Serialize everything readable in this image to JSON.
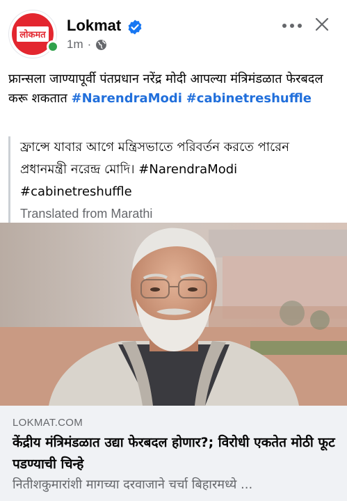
{
  "header": {
    "page_name": "Lokmat",
    "avatar_logo_text": "लोकमत",
    "timestamp": "1m",
    "separator": "·",
    "icons": {
      "verified": "verified-badge-icon",
      "privacy": "globe-icon",
      "more": "more-options-icon",
      "close": "close-icon"
    }
  },
  "post": {
    "text": "फ्रान्सला जाण्यापूर्वी पंतप्रधान नरेंद्र मोदी आपल्या मंत्रिमंडळात फेरबदल करू शकतात",
    "hashtag_1": "#NarendraModi",
    "hashtag_2": "#cabinetreshuffle"
  },
  "translation": {
    "text": "ফ্রান্সে যাবার আগে মন্ত্রিসভাতে পরিবর্তন করতে পারেন প্রধানমন্ত্রী নরেন্দ্র মোদি। #NarendraModi #cabinetreshuffle",
    "note": "Translated from Marathi"
  },
  "link_preview": {
    "domain": "LOKMAT.COM",
    "title": "केंद्रीय मंत्रिमंडळात उद्या फेरबदल होणार?; विरोधी एकतेत मोठी फूट पडण्याची चिन्हे",
    "description": "नितीशकुमारांशी मागच्या दरवाजाने चर्चा बिहारमध्ये ..."
  },
  "colors": {
    "brand_red": "#e3262f",
    "verified_blue": "#1877f2",
    "hashtag_blue": "#216fdb",
    "online_green": "#31a24c",
    "secondary_text": "#65676b",
    "preview_bg": "#f0f2f5"
  }
}
